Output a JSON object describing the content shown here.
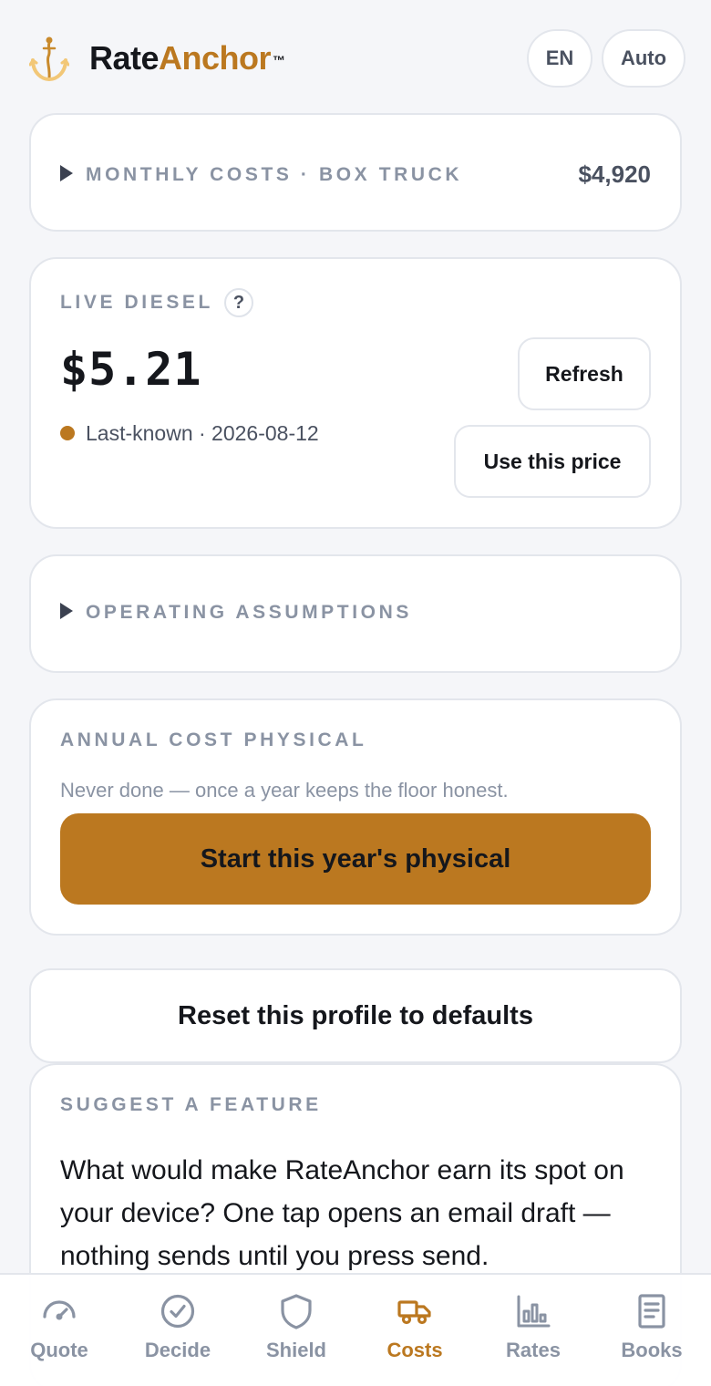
{
  "header": {
    "brand_part1": "Rate",
    "brand_part2": "Anchor",
    "brand_tm": "™",
    "language": "EN",
    "theme": "Auto"
  },
  "monthly_costs": {
    "label": "MONTHLY COSTS · BOX TRUCK",
    "total": "$4,920"
  },
  "diesel": {
    "label": "LIVE DIESEL",
    "help": "?",
    "price": "$5.21",
    "status": "Last-known · 2026-08-12",
    "refresh_label": "Refresh",
    "use_label": "Use this price"
  },
  "assumptions": {
    "label": "OPERATING ASSUMPTIONS"
  },
  "physical": {
    "label": "ANNUAL COST PHYSICAL",
    "note": "Never done — once a year keeps the floor honest.",
    "button": "Start this year's physical"
  },
  "reset": {
    "label": "Reset this profile to defaults"
  },
  "suggest": {
    "label": "SUGGEST A FEATURE",
    "body": "What would make RateAnchor earn its spot on your device? One tap opens an email draft — nothing sends until you press send."
  },
  "nav": {
    "items": [
      {
        "label": "Quote",
        "icon": "gauge-icon"
      },
      {
        "label": "Decide",
        "icon": "check-circle-icon"
      },
      {
        "label": "Shield",
        "icon": "shield-icon"
      },
      {
        "label": "Costs",
        "icon": "truck-icon"
      },
      {
        "label": "Rates",
        "icon": "bar-chart-icon"
      },
      {
        "label": "Books",
        "icon": "ledger-icon"
      }
    ],
    "active": "Costs"
  },
  "colors": {
    "accent": "#bb7820",
    "muted": "#8a93a3",
    "text": "#15171c",
    "background": "#f5f6f9"
  }
}
